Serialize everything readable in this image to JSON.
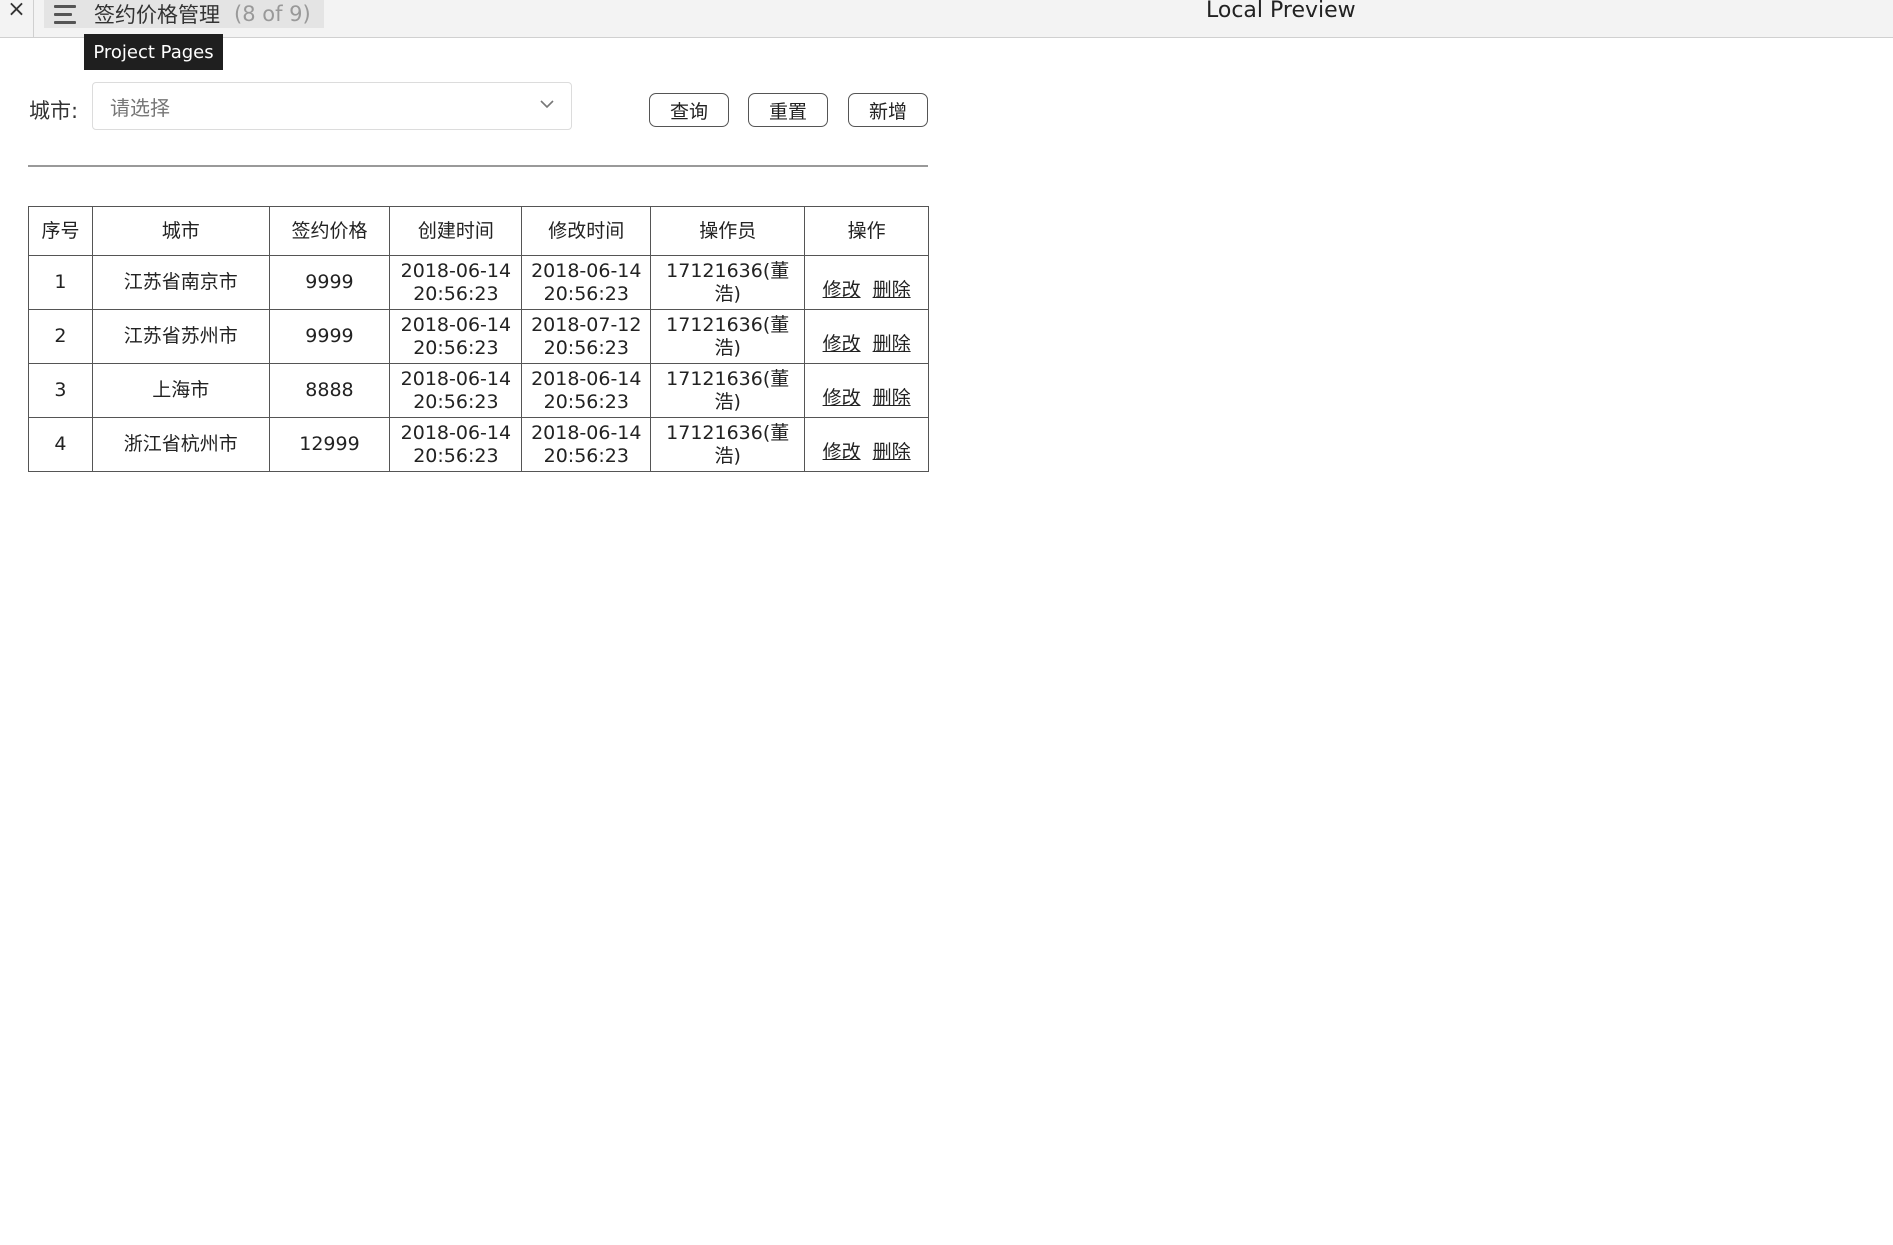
{
  "topbar": {
    "close_glyph": "×",
    "page_name": "签约价格管理",
    "page_count": "(8 of 9)",
    "preview_title": "Local Preview",
    "tooltip": "Project Pages"
  },
  "filter": {
    "city_label": "城市:",
    "city_placeholder": "请选择",
    "query_button": "查询",
    "reset_button": "重置",
    "add_button": "新增"
  },
  "table": {
    "headers": [
      "序号",
      "城市",
      "签约价格",
      "创建时间",
      "修改时间",
      "操作员",
      "操作"
    ],
    "rows": [
      {
        "no": "1",
        "city": "江苏省南京市",
        "price": "9999",
        "created": "2018-06-14\n20:56:23",
        "modified": "2018-06-14\n20:56:23",
        "operator": "17121636(董浩)",
        "edit": "修改",
        "delete": "删除"
      },
      {
        "no": "2",
        "city": "江苏省苏州市",
        "price": "9999",
        "created": "2018-06-14\n20:56:23",
        "modified": "2018-07-12\n20:56:23",
        "operator": "17121636(董浩)",
        "edit": "修改",
        "delete": "删除"
      },
      {
        "no": "3",
        "city": "上海市",
        "price": "8888",
        "created": "2018-06-14\n20:56:23",
        "modified": "2018-06-14\n20:56:23",
        "operator": "17121636(董浩)",
        "edit": "修改",
        "delete": "删除"
      },
      {
        "no": "4",
        "city": "浙江省杭州市",
        "price": "12999",
        "created": "2018-06-14\n20:56:23",
        "modified": "2018-06-14\n20:56:23",
        "operator": "17121636(董浩)",
        "edit": "修改",
        "delete": "删除"
      }
    ]
  },
  "icons": {
    "close": "close-icon",
    "menu": "hamburger-menu-icon",
    "dropdown": "chevron-down-icon"
  }
}
